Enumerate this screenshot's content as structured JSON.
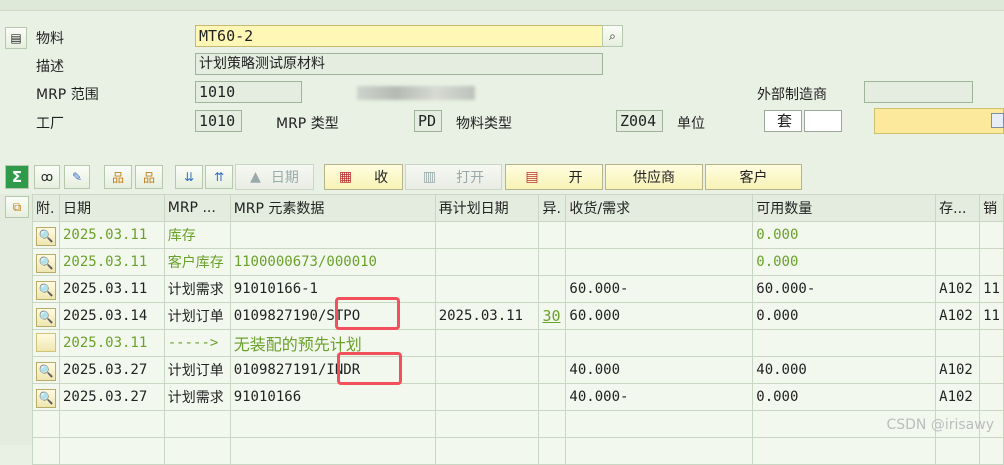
{
  "header": {
    "material_label": "物料",
    "material_value": "MT60-2",
    "description_label": "描述",
    "description_value": "计划策略测试原材料",
    "mrp_area_label": "MRP 范围",
    "mrp_area_value": "1010",
    "plant_label": "工厂",
    "plant_value": "1010",
    "mrp_type_label": "MRP 类型",
    "mrp_type_value": "PD",
    "material_type_label": "物料类型",
    "material_type_value": "Z004",
    "unit_label": "单位",
    "unit_value": "套",
    "ext_mfr_label": "外部制造商",
    "ext_mfr_value": ""
  },
  "toolbar": {
    "dates_label": "日期",
    "receipts_label": "收",
    "open_label": "打开",
    "issue_label": "开",
    "supplier_label": "供应商",
    "customer_label": "客户"
  },
  "grid": {
    "columns": [
      "附.",
      "日期",
      "MRP ...",
      "MRP 元素数据",
      "再计划日期",
      "异.",
      "收货/需求",
      "可用数量",
      "存...",
      "销"
    ],
    "rows": [
      {
        "date": "2025.03.11",
        "mrp": "库存",
        "data": "",
        "resched": "",
        "exc": "",
        "qty": "",
        "avail": "0.000",
        "stor": "",
        "s": "",
        "style": "green"
      },
      {
        "date": "2025.03.11",
        "mrp": "客户库存",
        "data": "1100000673/000010",
        "resched": "",
        "exc": "",
        "qty": "",
        "avail": "0.000",
        "stor": "",
        "s": "",
        "style": "green"
      },
      {
        "date": "2025.03.11",
        "mrp": "计划需求",
        "data": "91010166-1",
        "resched": "",
        "exc": "",
        "qty": "60.000-",
        "avail": "60.000-",
        "stor": "A102",
        "s": "11",
        "style": ""
      },
      {
        "date": "2025.03.14",
        "mrp": "计划订单",
        "data": "0109827190/STPO",
        "resched": "2025.03.11",
        "exc": "30",
        "qty": "60.000",
        "avail": "0.000",
        "stor": "A102",
        "s": "11",
        "style": ""
      },
      {
        "date": "2025.03.11",
        "mrp": "----->",
        "data": "无装配的预先计划",
        "resched": "",
        "exc": "",
        "qty": "",
        "avail": "",
        "stor": "",
        "s": "",
        "style": "green"
      },
      {
        "date": "2025.03.27",
        "mrp": "计划订单",
        "data": "0109827191/INDR",
        "resched": "",
        "exc": "",
        "qty": "40.000",
        "avail": "40.000",
        "stor": "A102",
        "s": "",
        "style": ""
      },
      {
        "date": "2025.03.27",
        "mrp": "计划需求",
        "data": "91010166",
        "resched": "",
        "exc": "",
        "qty": "40.000-",
        "avail": "0.000",
        "stor": "A102",
        "s": "",
        "style": ""
      }
    ]
  },
  "watermark": "CSDN @irisawy",
  "colors": {
    "highlight": "#f2505a",
    "green_text": "#6aa12a",
    "accent_yellow": "#fef7b5"
  },
  "icons": [
    "material-icon",
    "search-icon",
    "sum-icon",
    "glasses-icon",
    "pencil-icon",
    "tree-icon",
    "tree-expand-icon",
    "filter-down-icon",
    "filter-up-icon",
    "receipts-icon",
    "open-icon",
    "issue-icon",
    "magnify-icon",
    "pick-icon"
  ]
}
